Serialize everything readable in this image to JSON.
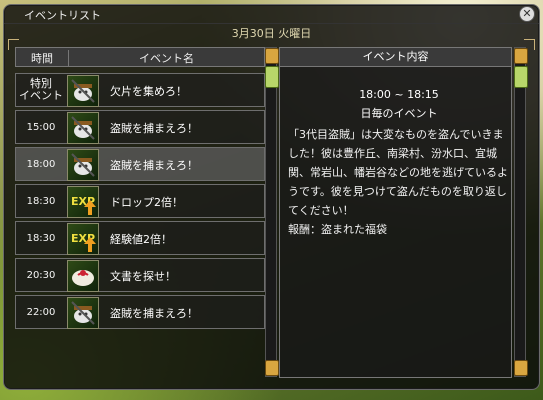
{
  "window": {
    "title": "イベントリスト"
  },
  "date": "3月30日 火曜日",
  "list": {
    "header_time": "時間",
    "header_name": "イベント名",
    "rows": [
      {
        "time": "特別\nイベント",
        "label": "欠片を集めろ！",
        "icon": "thief-icon"
      },
      {
        "time": "15:00",
        "label": "盗賊を捕まえろ！",
        "icon": "thief-icon"
      },
      {
        "time": "18:00",
        "label": "盗賊を捕まえろ！",
        "icon": "thief-icon",
        "selected": true
      },
      {
        "time": "18:30",
        "label": "ドロップ2倍！",
        "icon": "exp-up-icon"
      },
      {
        "time": "18:30",
        "label": "経験値2倍！",
        "icon": "exp-up-icon"
      },
      {
        "time": "20:30",
        "label": "文書を探せ！",
        "icon": "document-icon"
      },
      {
        "time": "22:00",
        "label": "盗賊を捕まえろ！",
        "icon": "thief-icon"
      }
    ]
  },
  "detail": {
    "header": "イベント内容",
    "time_range": "18:00  ~  18:15",
    "subtitle": "日毎のイベント",
    "text": "「3代目盗賊」は大変なものを盗んでいきました！彼は豊作丘、南梁村、汾水口、宜城関、常岩山、幡岩谷などの地を逃げているようです。彼を見つけて盗んだものを取り返してください！\n報酬：盗まれた福袋"
  },
  "colors": {
    "accent": "#c9b27a",
    "scroll_button": "#d9a640",
    "scroll_thumb": "#b8d66a"
  }
}
